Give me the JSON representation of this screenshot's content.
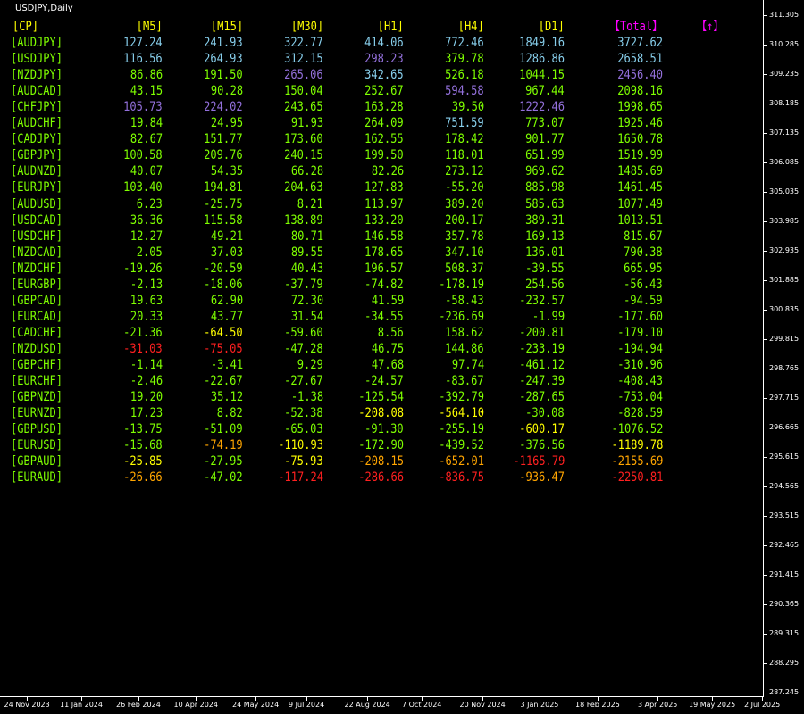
{
  "window": {
    "title": "USDJPY,Daily"
  },
  "price_axis": {
    "labels": [
      "311.305",
      "310.285",
      "309.235",
      "308.185",
      "307.135",
      "306.085",
      "305.035",
      "303.985",
      "302.935",
      "301.885",
      "300.835",
      "299.815",
      "298.765",
      "297.715",
      "296.665",
      "295.615",
      "294.565",
      "293.515",
      "292.465",
      "291.415",
      "290.365",
      "289.315",
      "288.295",
      "287.245"
    ]
  },
  "time_axis": {
    "labels": [
      "24 Nov 2023",
      "11 Jan 2024",
      "26 Feb 2024",
      "10 Apr 2024",
      "24 May 2024",
      "9 Jul 2024",
      "22 Aug 2024",
      "7 Oct 2024",
      "20 Nov 2024",
      "3 Jan 2025",
      "18 Feb 2025",
      "3 Apr 2025",
      "19 May 2025",
      "2 Jul 2025"
    ]
  },
  "table": {
    "headers": [
      "[CP]",
      "[M5]",
      "[M15]",
      "[M30]",
      "[H1]",
      "[H4]",
      "[D1]",
      "【Total】",
      "【↑】"
    ],
    "header_colors": [
      "#ffff00",
      "#ffff00",
      "#ffff00",
      "#ffff00",
      "#ffff00",
      "#ffff00",
      "#ffff00",
      "#ff00ff",
      "#ff00ff"
    ],
    "rows": [
      {
        "pair": "[AUDJPY]",
        "values": [
          "127.24",
          "241.93",
          "322.77",
          "414.06",
          "772.46",
          "1849.16",
          "3727.62"
        ],
        "colors": [
          "#87ceeb",
          "#87ceeb",
          "#87ceeb",
          "#87ceeb",
          "#87ceeb",
          "#87ceeb",
          "#87ceeb"
        ]
      },
      {
        "pair": "[USDJPY]",
        "values": [
          "116.56",
          "264.93",
          "312.15",
          "298.23",
          "379.78",
          "1286.86",
          "2658.51"
        ],
        "colors": [
          "#87ceeb",
          "#87ceeb",
          "#87ceeb",
          "#9370db",
          "#7fff00",
          "#87ceeb",
          "#87ceeb"
        ]
      },
      {
        "pair": "[NZDJPY]",
        "values": [
          "86.86",
          "191.50",
          "265.06",
          "342.65",
          "526.18",
          "1044.15",
          "2456.40"
        ],
        "colors": [
          "#7fff00",
          "#7fff00",
          "#9370db",
          "#87ceeb",
          "#7fff00",
          "#7fff00",
          "#9370db"
        ]
      },
      {
        "pair": "[AUDCAD]",
        "values": [
          "43.15",
          "90.28",
          "150.04",
          "252.67",
          "594.58",
          "967.44",
          "2098.16"
        ],
        "colors": [
          "#7fff00",
          "#7fff00",
          "#7fff00",
          "#7fff00",
          "#9370db",
          "#7fff00",
          "#7fff00"
        ]
      },
      {
        "pair": "[CHFJPY]",
        "values": [
          "105.73",
          "224.02",
          "243.65",
          "163.28",
          "39.50",
          "1222.46",
          "1998.65"
        ],
        "colors": [
          "#9370db",
          "#9370db",
          "#7fff00",
          "#7fff00",
          "#7fff00",
          "#9370db",
          "#7fff00"
        ]
      },
      {
        "pair": "[AUDCHF]",
        "values": [
          "19.84",
          "24.95",
          "91.93",
          "264.09",
          "751.59",
          "773.07",
          "1925.46"
        ],
        "colors": [
          "#7fff00",
          "#7fff00",
          "#7fff00",
          "#7fff00",
          "#87ceeb",
          "#7fff00",
          "#7fff00"
        ]
      },
      {
        "pair": "[CADJPY]",
        "values": [
          "82.67",
          "151.77",
          "173.60",
          "162.55",
          "178.42",
          "901.77",
          "1650.78"
        ],
        "colors": [
          "#7fff00",
          "#7fff00",
          "#7fff00",
          "#7fff00",
          "#7fff00",
          "#7fff00",
          "#7fff00"
        ]
      },
      {
        "pair": "[GBPJPY]",
        "values": [
          "100.58",
          "209.76",
          "240.15",
          "199.50",
          "118.01",
          "651.99",
          "1519.99"
        ],
        "colors": [
          "#7fff00",
          "#7fff00",
          "#7fff00",
          "#7fff00",
          "#7fff00",
          "#7fff00",
          "#7fff00"
        ]
      },
      {
        "pair": "[AUDNZD]",
        "values": [
          "40.07",
          "54.35",
          "66.28",
          "82.26",
          "273.12",
          "969.62",
          "1485.69"
        ],
        "colors": [
          "#7fff00",
          "#7fff00",
          "#7fff00",
          "#7fff00",
          "#7fff00",
          "#7fff00",
          "#7fff00"
        ]
      },
      {
        "pair": "[EURJPY]",
        "values": [
          "103.40",
          "194.81",
          "204.63",
          "127.83",
          "-55.20",
          "885.98",
          "1461.45"
        ],
        "colors": [
          "#7fff00",
          "#7fff00",
          "#7fff00",
          "#7fff00",
          "#7fff00",
          "#7fff00",
          "#7fff00"
        ]
      },
      {
        "pair": "[AUDUSD]",
        "values": [
          "6.23",
          "-25.75",
          "8.21",
          "113.97",
          "389.20",
          "585.63",
          "1077.49"
        ],
        "colors": [
          "#7fff00",
          "#7fff00",
          "#7fff00",
          "#7fff00",
          "#7fff00",
          "#7fff00",
          "#7fff00"
        ]
      },
      {
        "pair": "[USDCAD]",
        "values": [
          "36.36",
          "115.58",
          "138.89",
          "133.20",
          "200.17",
          "389.31",
          "1013.51"
        ],
        "colors": [
          "#7fff00",
          "#7fff00",
          "#7fff00",
          "#7fff00",
          "#7fff00",
          "#7fff00",
          "#7fff00"
        ]
      },
      {
        "pair": "[USDCHF]",
        "values": [
          "12.27",
          "49.21",
          "80.71",
          "146.58",
          "357.78",
          "169.13",
          "815.67"
        ],
        "colors": [
          "#7fff00",
          "#7fff00",
          "#7fff00",
          "#7fff00",
          "#7fff00",
          "#7fff00",
          "#7fff00"
        ]
      },
      {
        "pair": "[NZDCAD]",
        "values": [
          "2.05",
          "37.03",
          "89.55",
          "178.65",
          "347.10",
          "136.01",
          "790.38"
        ],
        "colors": [
          "#7fff00",
          "#7fff00",
          "#7fff00",
          "#7fff00",
          "#7fff00",
          "#7fff00",
          "#7fff00"
        ]
      },
      {
        "pair": "[NZDCHF]",
        "values": [
          "-19.26",
          "-20.59",
          "40.43",
          "196.57",
          "508.37",
          "-39.55",
          "665.95"
        ],
        "colors": [
          "#7fff00",
          "#7fff00",
          "#7fff00",
          "#7fff00",
          "#7fff00",
          "#7fff00",
          "#7fff00"
        ]
      },
      {
        "pair": "[EURGBP]",
        "values": [
          "-2.13",
          "-18.06",
          "-37.79",
          "-74.82",
          "-178.19",
          "254.56",
          "-56.43"
        ],
        "colors": [
          "#7fff00",
          "#7fff00",
          "#7fff00",
          "#7fff00",
          "#7fff00",
          "#7fff00",
          "#7fff00"
        ]
      },
      {
        "pair": "[GBPCAD]",
        "values": [
          "19.63",
          "62.90",
          "72.30",
          "41.59",
          "-58.43",
          "-232.57",
          "-94.59"
        ],
        "colors": [
          "#7fff00",
          "#7fff00",
          "#7fff00",
          "#7fff00",
          "#7fff00",
          "#7fff00",
          "#7fff00"
        ]
      },
      {
        "pair": "[EURCAD]",
        "values": [
          "20.33",
          "43.77",
          "31.54",
          "-34.55",
          "-236.69",
          "-1.99",
          "-177.60"
        ],
        "colors": [
          "#7fff00",
          "#7fff00",
          "#7fff00",
          "#7fff00",
          "#7fff00",
          "#7fff00",
          "#7fff00"
        ]
      },
      {
        "pair": "[CADCHF]",
        "values": [
          "-21.36",
          "-64.50",
          "-59.60",
          "8.56",
          "158.62",
          "-200.81",
          "-179.10"
        ],
        "colors": [
          "#7fff00",
          "#ffff00",
          "#7fff00",
          "#7fff00",
          "#7fff00",
          "#7fff00",
          "#7fff00"
        ]
      },
      {
        "pair": "[NZDUSD]",
        "values": [
          "-31.03",
          "-75.05",
          "-47.28",
          "46.75",
          "144.86",
          "-233.19",
          "-194.94"
        ],
        "colors": [
          "#ff2020",
          "#ff2020",
          "#7fff00",
          "#7fff00",
          "#7fff00",
          "#7fff00",
          "#7fff00"
        ]
      },
      {
        "pair": "[GBPCHF]",
        "values": [
          "-1.14",
          "-3.41",
          "9.29",
          "47.68",
          "97.74",
          "-461.12",
          "-310.96"
        ],
        "colors": [
          "#7fff00",
          "#7fff00",
          "#7fff00",
          "#7fff00",
          "#7fff00",
          "#7fff00",
          "#7fff00"
        ]
      },
      {
        "pair": "[EURCHF]",
        "values": [
          "-2.46",
          "-22.67",
          "-27.67",
          "-24.57",
          "-83.67",
          "-247.39",
          "-408.43"
        ],
        "colors": [
          "#7fff00",
          "#7fff00",
          "#7fff00",
          "#7fff00",
          "#7fff00",
          "#7fff00",
          "#7fff00"
        ]
      },
      {
        "pair": "[GBPNZD]",
        "values": [
          "19.20",
          "35.12",
          "-1.38",
          "-125.54",
          "-392.79",
          "-287.65",
          "-753.04"
        ],
        "colors": [
          "#7fff00",
          "#7fff00",
          "#7fff00",
          "#7fff00",
          "#7fff00",
          "#7fff00",
          "#7fff00"
        ]
      },
      {
        "pair": "[EURNZD]",
        "values": [
          "17.23",
          "8.82",
          "-52.38",
          "-208.08",
          "-564.10",
          "-30.08",
          "-828.59"
        ],
        "colors": [
          "#7fff00",
          "#7fff00",
          "#7fff00",
          "#ffff00",
          "#ffff00",
          "#7fff00",
          "#7fff00"
        ]
      },
      {
        "pair": "[GBPUSD]",
        "values": [
          "-13.75",
          "-51.09",
          "-65.03",
          "-91.30",
          "-255.19",
          "-600.17",
          "-1076.52"
        ],
        "colors": [
          "#7fff00",
          "#7fff00",
          "#7fff00",
          "#7fff00",
          "#7fff00",
          "#ffff00",
          "#7fff00"
        ]
      },
      {
        "pair": "[EURUSD]",
        "values": [
          "-15.68",
          "-74.19",
          "-110.93",
          "-172.90",
          "-439.52",
          "-376.56",
          "-1189.78"
        ],
        "colors": [
          "#7fff00",
          "#ffa500",
          "#ffff00",
          "#7fff00",
          "#7fff00",
          "#7fff00",
          "#ffff00"
        ]
      },
      {
        "pair": "[GBPAUD]",
        "values": [
          "-25.85",
          "-27.95",
          "-75.93",
          "-208.15",
          "-652.01",
          "-1165.79",
          "-2155.69"
        ],
        "colors": [
          "#ffff00",
          "#7fff00",
          "#ffff00",
          "#ffa500",
          "#ffa500",
          "#ff2020",
          "#ffa500"
        ]
      },
      {
        "pair": "[EURAUD]",
        "values": [
          "-26.66",
          "-47.02",
          "-117.24",
          "-286.66",
          "-836.75",
          "-936.47",
          "-2250.81"
        ],
        "colors": [
          "#ffa500",
          "#7fff00",
          "#ff2020",
          "#ff2020",
          "#ff2020",
          "#ffa500",
          "#ff2020"
        ]
      }
    ]
  }
}
